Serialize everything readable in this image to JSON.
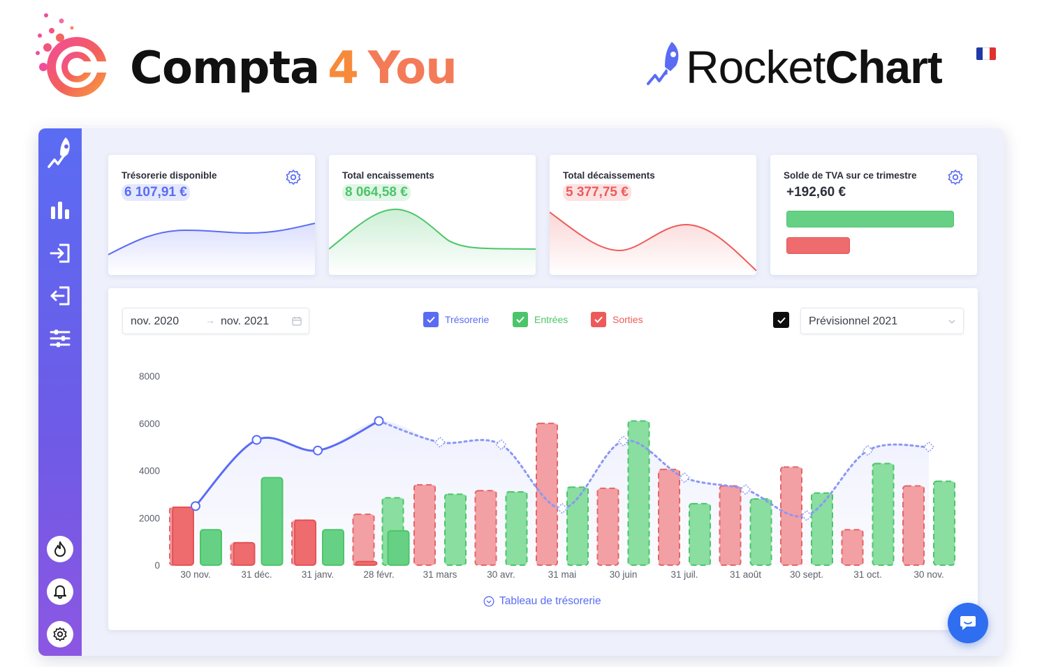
{
  "brand": {
    "word1": "Compta",
    "word2": "4",
    "word3": "You"
  },
  "partner": {
    "regular": "Rocket",
    "bold": "Chart",
    "flag_colors": [
      "#1f3aa5",
      "#ffffff",
      "#e2312f"
    ]
  },
  "sidebar": {
    "items": [
      "rocket-icon",
      "bar-chart-icon",
      "login-icon",
      "logout-icon",
      "sliders-icon"
    ],
    "bottom_items": [
      "flame-icon",
      "bell-icon",
      "gear-icon"
    ]
  },
  "colors": {
    "accent": "#5a6cf3",
    "green": "#4cc56a",
    "red": "#ee5a5a",
    "green_light": "#89dea0",
    "red_light": "#f2a0a3"
  },
  "kpis": [
    {
      "title": "Trésorerie disponible",
      "value": "6 107,91 €",
      "color": "#5a6cf3",
      "badge": "#e4e8fd"
    },
    {
      "title": "Total encaissements",
      "value": "8 064,58 €",
      "color": "#4cc56a",
      "badge": "#e1f6e6"
    },
    {
      "title": "Total décaissements",
      "value": "5 377,75 €",
      "color": "#ee5a5a",
      "badge": "#fde2e2"
    },
    {
      "title": "Solde de TVA sur ce trimestre",
      "value": "+192,60 €",
      "color": "#2b2f3a",
      "badge": "transparent"
    }
  ],
  "tva": {
    "collected_share": 1.0,
    "deductible_share": 0.38
  },
  "filters": {
    "date_from": "nov. 2020",
    "arrow": "→",
    "date_to": "nov. 2021",
    "legend": [
      {
        "label": "Trésorerie",
        "color": "#5a6cf3",
        "checked": true
      },
      {
        "label": "Entrées",
        "color": "#4cc56a",
        "checked": true
      },
      {
        "label": "Sorties",
        "color": "#ee5a5a",
        "checked": true
      }
    ],
    "forecast_checked": true,
    "scenario": "Prévisionnel 2021"
  },
  "chart_data": {
    "type": "bar",
    "categories": [
      "30 nov.",
      "31 déc.",
      "31 janv.",
      "28 févr.",
      "31 mars",
      "30 avr.",
      "31 mai",
      "30 juin",
      "31 juil.",
      "31 août",
      "30 sept.",
      "31 oct.",
      "30 nov."
    ],
    "ylim": [
      0,
      8000
    ],
    "yticks": [
      0,
      2000,
      4000,
      6000,
      8000
    ],
    "series": [
      {
        "name": "Sorties",
        "values": [
          2450,
          950,
          1900,
          2150,
          3400,
          3150,
          6000,
          3250,
          4050,
          3350,
          4150,
          1500,
          3350
        ]
      },
      {
        "name": "Entrées",
        "values": [
          1500,
          3700,
          1500,
          2850,
          3000,
          3100,
          3300,
          6100,
          2600,
          2800,
          3050,
          4300,
          3550
        ]
      },
      {
        "name": "Trésorerie",
        "values": [
          2500,
          5300,
          4850,
          6100,
          5200,
          5100,
          2400,
          5250,
          3700,
          3200,
          2100,
          4850,
          5000
        ]
      }
    ],
    "actual_months": 4,
    "partial_bars": {
      "Sorties": [
        2450,
        950,
        1900,
        150
      ],
      "Entrées": [
        1500,
        3700,
        1500,
        1450
      ]
    }
  },
  "footer": {
    "table_link": "Tableau de trésorerie"
  }
}
